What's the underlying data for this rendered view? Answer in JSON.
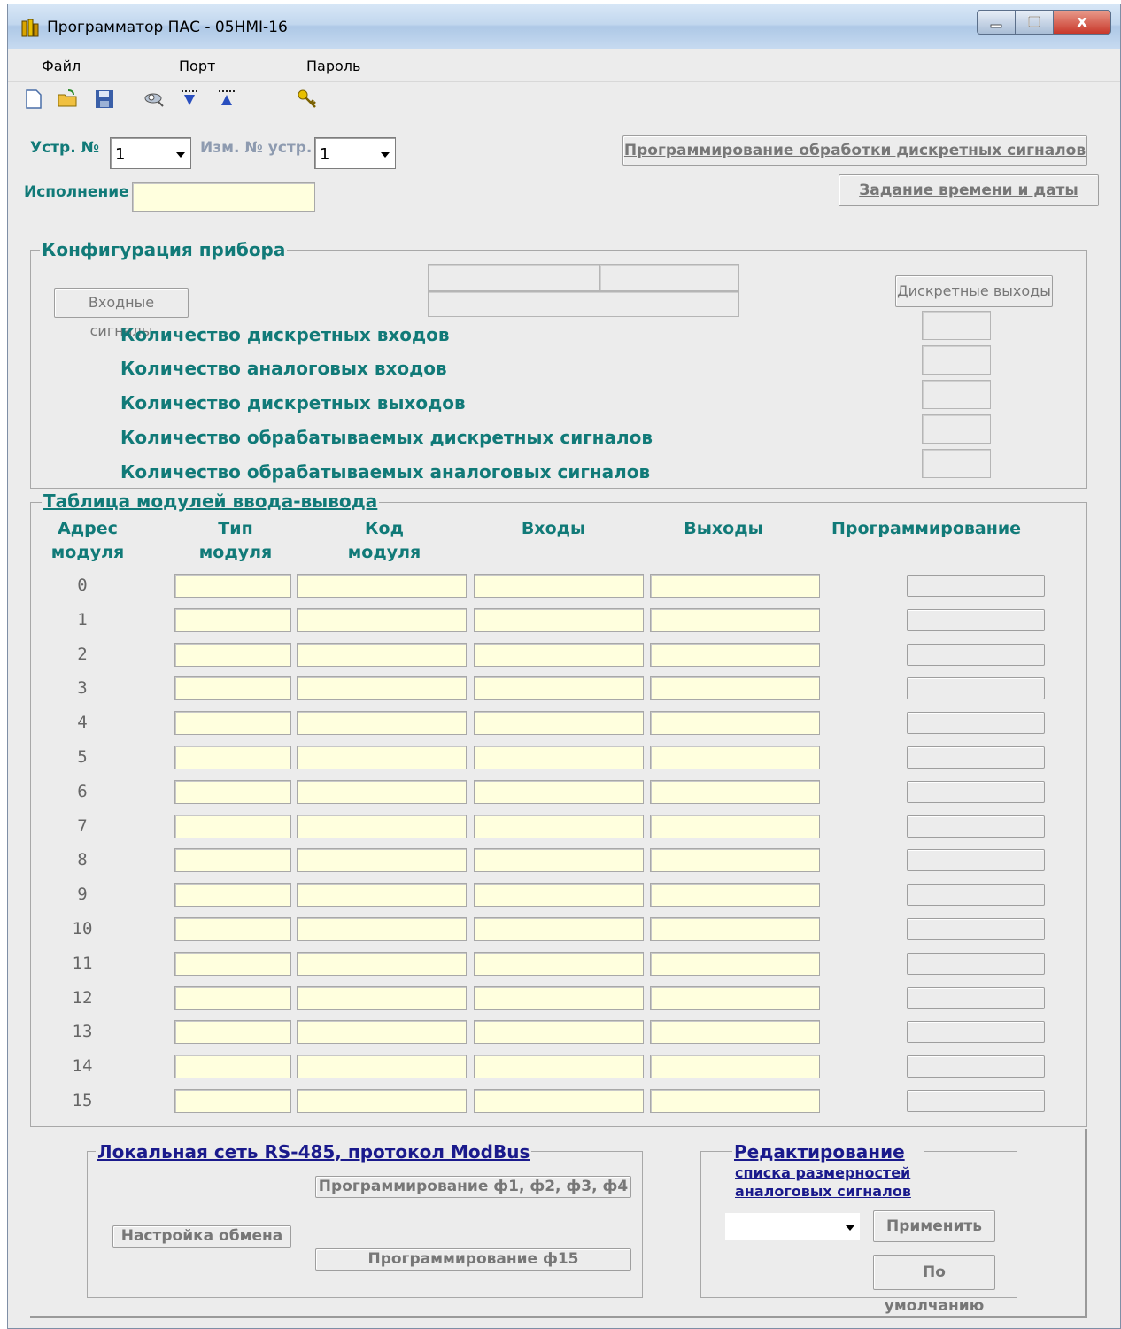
{
  "window": {
    "title": "Программатор ПАС - 05HMI-16",
    "close_glyph": "x"
  },
  "menu": {
    "items": [
      "Файл",
      "Порт",
      "Пароль"
    ]
  },
  "toolbar": {
    "icons": [
      "new-file-icon",
      "open-folder-icon",
      "save-icon",
      "search-device-icon",
      "read-down-icon",
      "write-up-icon",
      "key-icon"
    ]
  },
  "device": {
    "ustr_label": "Устр. №",
    "ustr_value": "1",
    "izm_label": "Изм. № устр.",
    "izm_value": "1",
    "ispolnenie_label": "Исполнение",
    "ispolnenie_value": ""
  },
  "buttons": {
    "prog_discrete": "Программирование обработки дискретных сигналов",
    "set_time": "Задание времени и даты"
  },
  "config": {
    "title": "Конфигурация прибора",
    "input_signals_btn": "Входные сигналы",
    "discrete_outputs_btn": "Дискретные выходы",
    "rows": [
      "Количество дискретных входов",
      "Количество аналоговых входов",
      "Количество дискретных выходов",
      "Количество обрабатываемых дискретных сигналов",
      "Количество обрабатываемых аналоговых сигналов"
    ]
  },
  "modules": {
    "title": "Таблица модулей ввода-вывода",
    "headers": {
      "address": "Адрес\nмодуля",
      "type": "Тип\nмодуля",
      "code": "Код\nмодуля",
      "inputs": "Входы",
      "outputs": "Выходы",
      "programming": "Программирование"
    },
    "rows": [
      "0",
      "1",
      "2",
      "3",
      "4",
      "5",
      "6",
      "7",
      "8",
      "9",
      "10",
      "11",
      "12",
      "13",
      "14",
      "15"
    ]
  },
  "network": {
    "title": "Локальная сеть RS-485, протокол ModBus",
    "prog_f1_4": "Программирование ф1, ф2, ф3, ф4",
    "exchange_settings": "Настройка обмена",
    "prog_f15": "Программирование ф15"
  },
  "editing": {
    "title": "Редактирование",
    "subtitle_line1": "списка размерностей",
    "subtitle_line2": "аналоговых сигналов",
    "select_value": "",
    "apply": "Применить",
    "default": "По умолчанию"
  },
  "colors": {
    "accent_teal": "#117a78",
    "field_yellow": "#ffffde",
    "link_blue": "#1a1a8c"
  }
}
